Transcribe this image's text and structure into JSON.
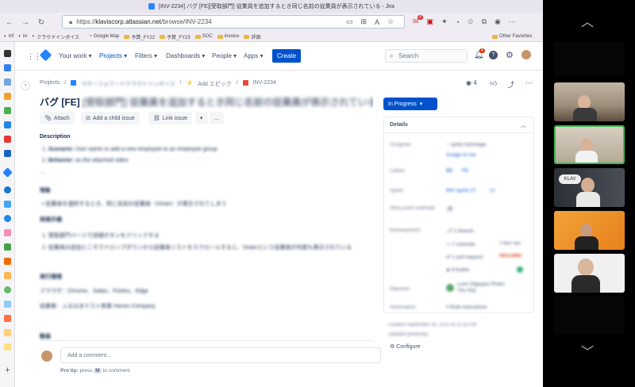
{
  "browser": {
    "title": "[INV-2234] バグ [FE][受取部門] 従業員を追加するとき同じ名前の従業員が表示されている - Jira",
    "url_prefix": "https://",
    "url_domain": "klaviscorp.atlassian.net",
    "url_path": "/browse/INV-2234",
    "extension_badge": "4",
    "bookmarks": [
      "mf",
      "iiv",
      "クラウドインボイス",
      "Google Map",
      "予算_FY22",
      "予算_FY23",
      "SOC",
      "invoice",
      "評価"
    ],
    "other_favorites": "Other Favorites"
  },
  "jira_nav": {
    "your_work": "Your work",
    "projects": "Projects",
    "filters": "Filters",
    "dashboards": "Dashboards",
    "people": "People",
    "apps": "Apps",
    "create": "Create",
    "search_placeholder": "Search",
    "notif_count": "4"
  },
  "issue": {
    "breadcrumb": [
      "Projects",
      "マネーフォワードクラウドインボイス",
      "Add エピック",
      "INV-2234"
    ],
    "watchers": "4",
    "title_prefix": "バグ [FE]",
    "title_rest": "[受取部門] 従業員を追加するとき同じ名前の従業員が表示されている",
    "toolbar": {
      "attach": "Attach",
      "add_child": "Add a child issue",
      "link_issue": "Link issue",
      "more": "..."
    },
    "description_heading": "Description",
    "desc_items": [
      {
        "label": "Scenario:",
        "text": "User wants to add a new employee to an employee group"
      },
      {
        "label": "Behavior:",
        "text": "as the attached video"
      }
    ],
    "dashes": "---",
    "gensho_heading": "現象",
    "gensho_item": "従業員を選択するとき、同じ名前の従業員（Vivian）が表示されてしまう",
    "repro_heading": "再現手順",
    "repro_items": [
      "受取部門ページで詳細ボタンをクリックする",
      "従業員の追加ところでドロップダウンから従業員リストをスクロールすると、Vivianという従業員が何度も表示されている"
    ],
    "env_heading": "実行環境",
    "env_browser": "ブラウザ：Chrome、Safari、Firefox、Edge",
    "env_user": "従業者：ふるはまテスト商事 Hanon Company",
    "activity_heading": "動画",
    "comment_placeholder": "Add a comment...",
    "pro_tip_prefix": "Pro tip:",
    "pro_tip_press": "press",
    "pro_tip_key": "M",
    "pro_tip_suffix": "to comment"
  },
  "details": {
    "status": "In Progress",
    "heading": "Details",
    "assignee_label": "Assignee",
    "assignee": "ryoko tominaga",
    "assign_to_me": "Assign to me",
    "labels_label": "Labels",
    "labels": [
      "BE",
      "FE"
    ],
    "sprint_label": "Sprint",
    "sprint": "INV sprint 27",
    "sprint_more": "+2",
    "story_points_label": "Story point estimate",
    "story_points": "5",
    "development_label": "Development",
    "branch": "1 branch",
    "commits": "7 commits",
    "commits_time": "2 days ago",
    "pull_request": "1 pull request",
    "pr_status": "DECLINED",
    "builds": "8 builds",
    "reporter_label": "Reporter",
    "reporter": "Luon (Nguyen Pham Thu Ha)",
    "automation_label": "Automation",
    "automation": "Rule executions",
    "created": "Created September 28, 2022 at 12:53 PM",
    "updated": "Updated yesterday",
    "configure": "Configure"
  },
  "zoom": {
    "top_chevron": "︿",
    "bottom_chevron": "﹀",
    "tile_names": [
      "",
      "",
      "",
      "",
      ""
    ]
  },
  "colors": {
    "jira_blue": "#0052cc",
    "in_progress": "#0052cc",
    "active_speaker_border": "#3fb950",
    "declined": "#de350b"
  }
}
